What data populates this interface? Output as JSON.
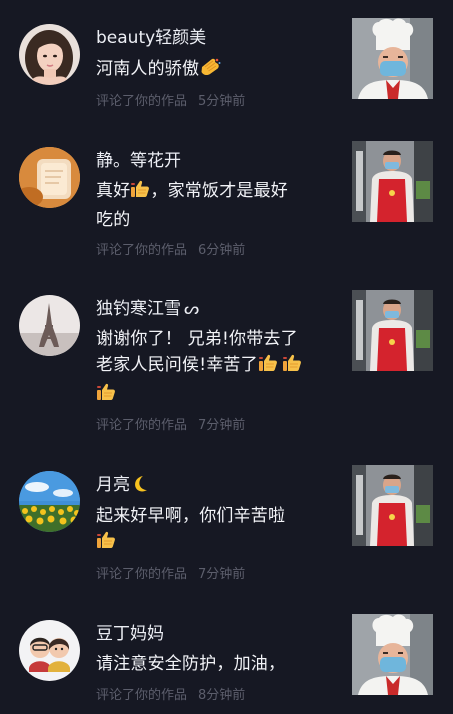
{
  "notifications": [
    {
      "username": "beauty轻颜美",
      "comment": "河南人的骄傲",
      "comment_emoji": "applause-emoji",
      "action": "评论了你的作品",
      "time": "5分钟前",
      "avatar_icon": "woman-portrait-avatar",
      "thumbnail_icon": "chef-with-mask-thumbnail"
    },
    {
      "username": "静。等花开",
      "comment_part1": "真好",
      "comment_emoji": "thumbs-up-emoji",
      "comment_part2": "，家常饭才是最好",
      "comment_line2": "吃的",
      "action": "评论了你的作品",
      "time": "6分钟前",
      "avatar_icon": "bread-toast-avatar",
      "thumbnail_icon": "cook-red-apron-thumbnail"
    },
    {
      "username": "独钓寒江雪",
      "username_symbol": "ᔕ",
      "comment_line1": "谢谢你了！ 兄弟!你带去了",
      "comment_line2": "老家人民问侯!幸苦了",
      "comment_emoji": "thumbs-up-emoji",
      "action": "评论了你的作品",
      "time": "7分钟前",
      "avatar_icon": "eiffel-tower-avatar",
      "thumbnail_icon": "cook-red-apron-thumbnail"
    },
    {
      "username": "月亮",
      "username_emoji": "crescent-moon-emoji",
      "comment_line1": "起来好早啊，你们辛苦啦",
      "comment_emoji": "thumbs-up-emoji",
      "action": "评论了你的作品",
      "time": "7分钟前",
      "avatar_icon": "sunflower-field-avatar",
      "thumbnail_icon": "cook-red-apron-thumbnail"
    },
    {
      "username": "豆丁妈妈",
      "comment_line1": "请注意安全防护，加油，",
      "action": "评论了你的作品",
      "time": "8分钟前",
      "avatar_icon": "cartoon-couple-avatar",
      "thumbnail_icon": "chef-with-mask-thumbnail"
    }
  ],
  "colors": {
    "background": "#161823",
    "primary_text": "#f2f3f7",
    "secondary_text": "#5c5e6c",
    "emoji_yellow": "#f7b733"
  }
}
